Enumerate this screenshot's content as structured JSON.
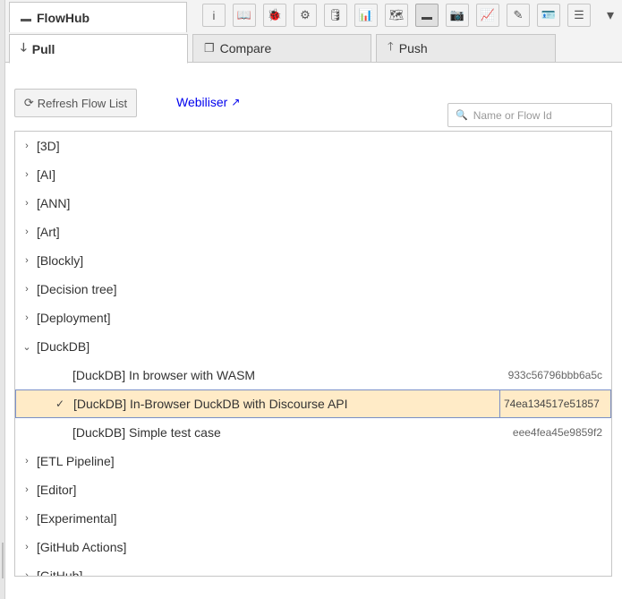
{
  "header": {
    "title": "FlowHub",
    "toolbar": [
      {
        "name": "info-icon",
        "glyph": "i"
      },
      {
        "name": "book-icon",
        "glyph": "📖"
      },
      {
        "name": "bug-icon",
        "glyph": "🐞"
      },
      {
        "name": "gear-icon",
        "glyph": "⚙"
      },
      {
        "name": "database-icon",
        "glyph": "🛢"
      },
      {
        "name": "bar-chart-icon",
        "glyph": "📊"
      },
      {
        "name": "map-icon",
        "glyph": "🗺"
      },
      {
        "name": "minus-icon",
        "glyph": "",
        "active": true
      },
      {
        "name": "camera-icon",
        "glyph": "📷"
      },
      {
        "name": "area-chart-icon",
        "glyph": "📈"
      },
      {
        "name": "edit-icon",
        "glyph": "✎"
      },
      {
        "name": "id-card-icon",
        "glyph": "🪪"
      },
      {
        "name": "outdent-icon",
        "glyph": "☰"
      }
    ],
    "caret": "▾"
  },
  "tabs": {
    "pull": {
      "icon": "🡓",
      "label": "Pull"
    },
    "compare": {
      "icon": "❐",
      "label": "Compare"
    },
    "push": {
      "icon": "🡑",
      "label": "Push"
    }
  },
  "controls": {
    "refresh_icon": "⟳",
    "refresh_label": "Refresh Flow List",
    "webiliser_label": "Webiliser",
    "webiliser_ext_icon": "↗",
    "search_icon": "🔍",
    "search_placeholder": "Name or Flow Id"
  },
  "tree": {
    "groups_before": [
      "[3D]",
      "[AI]",
      "[ANN]",
      "[Art]",
      "[Blockly]",
      "[Decision tree]",
      "[Deployment]"
    ],
    "expanded_group": "[DuckDB]",
    "flows": [
      {
        "label": "[DuckDB] In browser with WASM",
        "id": "933c56796bbb6a5c",
        "selected": false
      },
      {
        "label": "[DuckDB] In-Browser DuckDB with Discourse API",
        "id": "74ea134517e51857",
        "selected": true
      },
      {
        "label": "[DuckDB] Simple test case",
        "id": "eee4fea45e9859f2",
        "selected": false
      }
    ],
    "groups_after": [
      "[ETL Pipeline]",
      "[Editor]",
      "[Experimental]",
      "[GitHub Actions]",
      "[GitHub]"
    ],
    "collapsed_chevron": "›",
    "expanded_chevron": "⌄",
    "selected_check": "✓"
  }
}
